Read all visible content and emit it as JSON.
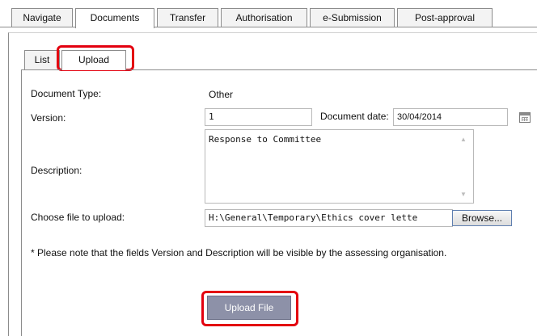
{
  "top_tabs": [
    {
      "label": "Navigate"
    },
    {
      "label": "Documents"
    },
    {
      "label": "Transfer"
    },
    {
      "label": "Authorisation"
    },
    {
      "label": "e-Submission"
    },
    {
      "label": "Post-approval"
    }
  ],
  "sub_tabs": [
    {
      "label": "List"
    },
    {
      "label": "Upload"
    }
  ],
  "form": {
    "document_type_label": "Document Type:",
    "document_type_value": "Other",
    "version_label": "Version:",
    "version_value": "1",
    "document_date_label": "Document date:",
    "document_date_value": "30/04/2014",
    "description_label": "Description:",
    "description_value": "Response to Committee",
    "file_label": "Choose file to upload:",
    "file_value": "H:\\General\\Temporary\\Ethics cover lette",
    "browse_label": "Browse...",
    "note": "* Please note that the fields Version and Description will be visible by the assessing organisation.",
    "upload_label": "Upload File"
  },
  "colors": {
    "highlight": "#e3000f",
    "upload_button": "#8d91a8"
  }
}
